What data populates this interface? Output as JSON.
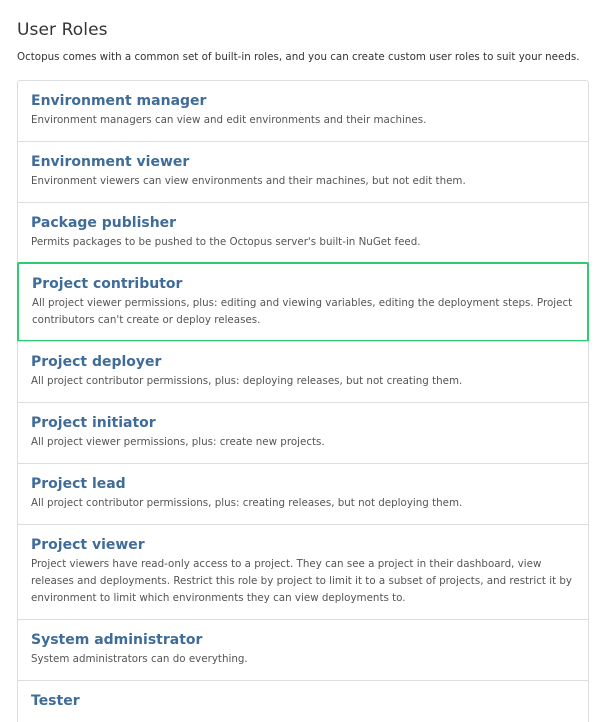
{
  "header": {
    "title": "User Roles",
    "description": "Octopus comes with a common set of built-in roles, and you can create custom user roles to suit your needs."
  },
  "colors": {
    "role_name": "#3f6c99",
    "selected_border": "#2ecc71",
    "divider": "#dddddd"
  },
  "roles": [
    {
      "name": "Environment manager",
      "description": "Environment managers can view and edit environments and their machines."
    },
    {
      "name": "Environment viewer",
      "description": "Environment viewers can view environments and their machines, but not edit them."
    },
    {
      "name": "Package publisher",
      "description": "Permits packages to be pushed to the Octopus server's built-in NuGet feed."
    },
    {
      "name": "Project contributor",
      "description": "All project viewer permissions, plus: editing and viewing variables, editing the deployment steps. Project contributors can't create or deploy releases.",
      "selected": true
    },
    {
      "name": "Project deployer",
      "description": "All project contributor permissions, plus: deploying releases, but not creating them."
    },
    {
      "name": "Project initiator",
      "description": "All project viewer permissions, plus: create new projects."
    },
    {
      "name": "Project lead",
      "description": "All project contributor permissions, plus: creating releases, but not deploying them."
    },
    {
      "name": "Project viewer",
      "description": "Project viewers have read-only access to a project. They can see a project in their dashboard, view releases and deployments. Restrict this role by project to limit it to a subset of projects, and restrict it by environment to limit which environments they can view deployments to."
    },
    {
      "name": "System administrator",
      "description": "System administrators can do everything."
    },
    {
      "name": "Tester",
      "description": ""
    }
  ]
}
